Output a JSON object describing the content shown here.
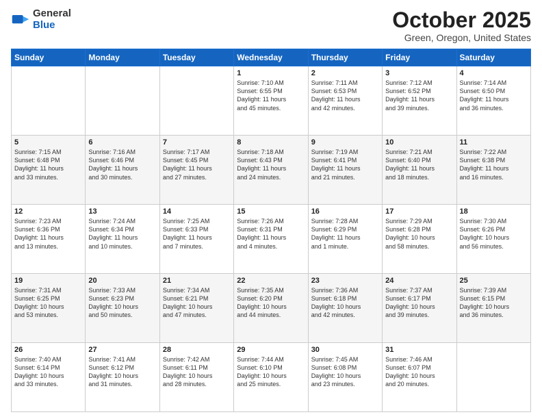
{
  "header": {
    "logo_general": "General",
    "logo_blue": "Blue",
    "month_title": "October 2025",
    "location": "Green, Oregon, United States"
  },
  "days_of_week": [
    "Sunday",
    "Monday",
    "Tuesday",
    "Wednesday",
    "Thursday",
    "Friday",
    "Saturday"
  ],
  "weeks": [
    [
      {
        "num": "",
        "info": ""
      },
      {
        "num": "",
        "info": ""
      },
      {
        "num": "",
        "info": ""
      },
      {
        "num": "1",
        "info": "Sunrise: 7:10 AM\nSunset: 6:55 PM\nDaylight: 11 hours\nand 45 minutes."
      },
      {
        "num": "2",
        "info": "Sunrise: 7:11 AM\nSunset: 6:53 PM\nDaylight: 11 hours\nand 42 minutes."
      },
      {
        "num": "3",
        "info": "Sunrise: 7:12 AM\nSunset: 6:52 PM\nDaylight: 11 hours\nand 39 minutes."
      },
      {
        "num": "4",
        "info": "Sunrise: 7:14 AM\nSunset: 6:50 PM\nDaylight: 11 hours\nand 36 minutes."
      }
    ],
    [
      {
        "num": "5",
        "info": "Sunrise: 7:15 AM\nSunset: 6:48 PM\nDaylight: 11 hours\nand 33 minutes."
      },
      {
        "num": "6",
        "info": "Sunrise: 7:16 AM\nSunset: 6:46 PM\nDaylight: 11 hours\nand 30 minutes."
      },
      {
        "num": "7",
        "info": "Sunrise: 7:17 AM\nSunset: 6:45 PM\nDaylight: 11 hours\nand 27 minutes."
      },
      {
        "num": "8",
        "info": "Sunrise: 7:18 AM\nSunset: 6:43 PM\nDaylight: 11 hours\nand 24 minutes."
      },
      {
        "num": "9",
        "info": "Sunrise: 7:19 AM\nSunset: 6:41 PM\nDaylight: 11 hours\nand 21 minutes."
      },
      {
        "num": "10",
        "info": "Sunrise: 7:21 AM\nSunset: 6:40 PM\nDaylight: 11 hours\nand 18 minutes."
      },
      {
        "num": "11",
        "info": "Sunrise: 7:22 AM\nSunset: 6:38 PM\nDaylight: 11 hours\nand 16 minutes."
      }
    ],
    [
      {
        "num": "12",
        "info": "Sunrise: 7:23 AM\nSunset: 6:36 PM\nDaylight: 11 hours\nand 13 minutes."
      },
      {
        "num": "13",
        "info": "Sunrise: 7:24 AM\nSunset: 6:34 PM\nDaylight: 11 hours\nand 10 minutes."
      },
      {
        "num": "14",
        "info": "Sunrise: 7:25 AM\nSunset: 6:33 PM\nDaylight: 11 hours\nand 7 minutes."
      },
      {
        "num": "15",
        "info": "Sunrise: 7:26 AM\nSunset: 6:31 PM\nDaylight: 11 hours\nand 4 minutes."
      },
      {
        "num": "16",
        "info": "Sunrise: 7:28 AM\nSunset: 6:29 PM\nDaylight: 11 hours\nand 1 minute."
      },
      {
        "num": "17",
        "info": "Sunrise: 7:29 AM\nSunset: 6:28 PM\nDaylight: 10 hours\nand 58 minutes."
      },
      {
        "num": "18",
        "info": "Sunrise: 7:30 AM\nSunset: 6:26 PM\nDaylight: 10 hours\nand 56 minutes."
      }
    ],
    [
      {
        "num": "19",
        "info": "Sunrise: 7:31 AM\nSunset: 6:25 PM\nDaylight: 10 hours\nand 53 minutes."
      },
      {
        "num": "20",
        "info": "Sunrise: 7:33 AM\nSunset: 6:23 PM\nDaylight: 10 hours\nand 50 minutes."
      },
      {
        "num": "21",
        "info": "Sunrise: 7:34 AM\nSunset: 6:21 PM\nDaylight: 10 hours\nand 47 minutes."
      },
      {
        "num": "22",
        "info": "Sunrise: 7:35 AM\nSunset: 6:20 PM\nDaylight: 10 hours\nand 44 minutes."
      },
      {
        "num": "23",
        "info": "Sunrise: 7:36 AM\nSunset: 6:18 PM\nDaylight: 10 hours\nand 42 minutes."
      },
      {
        "num": "24",
        "info": "Sunrise: 7:37 AM\nSunset: 6:17 PM\nDaylight: 10 hours\nand 39 minutes."
      },
      {
        "num": "25",
        "info": "Sunrise: 7:39 AM\nSunset: 6:15 PM\nDaylight: 10 hours\nand 36 minutes."
      }
    ],
    [
      {
        "num": "26",
        "info": "Sunrise: 7:40 AM\nSunset: 6:14 PM\nDaylight: 10 hours\nand 33 minutes."
      },
      {
        "num": "27",
        "info": "Sunrise: 7:41 AM\nSunset: 6:12 PM\nDaylight: 10 hours\nand 31 minutes."
      },
      {
        "num": "28",
        "info": "Sunrise: 7:42 AM\nSunset: 6:11 PM\nDaylight: 10 hours\nand 28 minutes."
      },
      {
        "num": "29",
        "info": "Sunrise: 7:44 AM\nSunset: 6:10 PM\nDaylight: 10 hours\nand 25 minutes."
      },
      {
        "num": "30",
        "info": "Sunrise: 7:45 AM\nSunset: 6:08 PM\nDaylight: 10 hours\nand 23 minutes."
      },
      {
        "num": "31",
        "info": "Sunrise: 7:46 AM\nSunset: 6:07 PM\nDaylight: 10 hours\nand 20 minutes."
      },
      {
        "num": "",
        "info": ""
      }
    ]
  ]
}
